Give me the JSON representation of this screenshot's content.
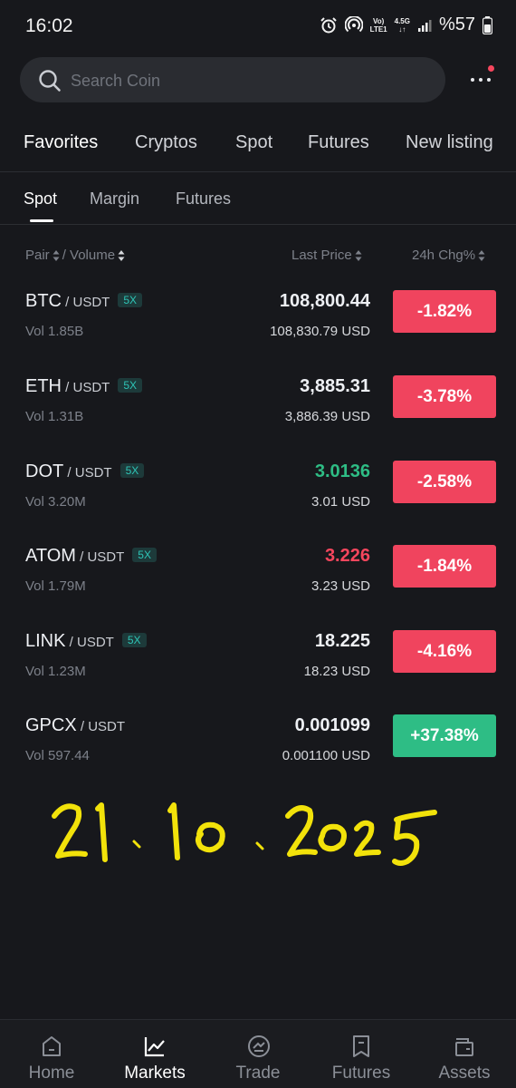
{
  "status_bar": {
    "time": "16:02",
    "network_top": "Vo)",
    "network_bottom": "LTE1",
    "network_type": "4.5G",
    "battery": "%57"
  },
  "search": {
    "placeholder": "Search Coin"
  },
  "category_tabs": [
    "Favorites",
    "Cryptos",
    "Spot",
    "Futures",
    "New listing"
  ],
  "sub_tabs": [
    "Spot",
    "Margin",
    "Futures"
  ],
  "columns": {
    "pair": "Pair",
    "volume": "/ Volume",
    "last_price": "Last Price",
    "change": "24h Chg%"
  },
  "rows": [
    {
      "base": "BTC",
      "quote": "USDT",
      "leverage": "5X",
      "volume": "Vol 1.85B",
      "price": "108,800.44",
      "price_trend": "neutral",
      "usd": "108,830.79 USD",
      "change": "-1.82%",
      "change_dir": "down"
    },
    {
      "base": "ETH",
      "quote": "USDT",
      "leverage": "5X",
      "volume": "Vol 1.31B",
      "price": "3,885.31",
      "price_trend": "neutral",
      "usd": "3,886.39 USD",
      "change": "-3.78%",
      "change_dir": "down"
    },
    {
      "base": "DOT",
      "quote": "USDT",
      "leverage": "5X",
      "volume": "Vol 3.20M",
      "price": "3.0136",
      "price_trend": "up",
      "usd": "3.01 USD",
      "change": "-2.58%",
      "change_dir": "down"
    },
    {
      "base": "ATOM",
      "quote": "USDT",
      "leverage": "5X",
      "volume": "Vol 1.79M",
      "price": "3.226",
      "price_trend": "down",
      "usd": "3.23 USD",
      "change": "-1.84%",
      "change_dir": "down"
    },
    {
      "base": "LINK",
      "quote": "USDT",
      "leverage": "5X",
      "volume": "Vol 1.23M",
      "price": "18.225",
      "price_trend": "neutral",
      "usd": "18.23 USD",
      "change": "-4.16%",
      "change_dir": "down"
    },
    {
      "base": "GPCX",
      "quote": "USDT",
      "leverage": "",
      "volume": "Vol 597.44",
      "price": "0.001099",
      "price_trend": "neutral",
      "usd": "0.001100 USD",
      "change": "+37.38%",
      "change_dir": "up"
    }
  ],
  "handwritten_note": "21.10.2025",
  "bottom_nav": [
    {
      "label": "Home",
      "icon": "home-icon"
    },
    {
      "label": "Markets",
      "icon": "markets-icon",
      "active": true
    },
    {
      "label": "Trade",
      "icon": "trade-icon"
    },
    {
      "label": "Futures",
      "icon": "futures-icon"
    },
    {
      "label": "Assets",
      "icon": "assets-icon"
    }
  ],
  "colors": {
    "background": "#17181c",
    "up": "#2ebd85",
    "down": "#f6465d",
    "leverage_badge": "#2ec4b6"
  }
}
